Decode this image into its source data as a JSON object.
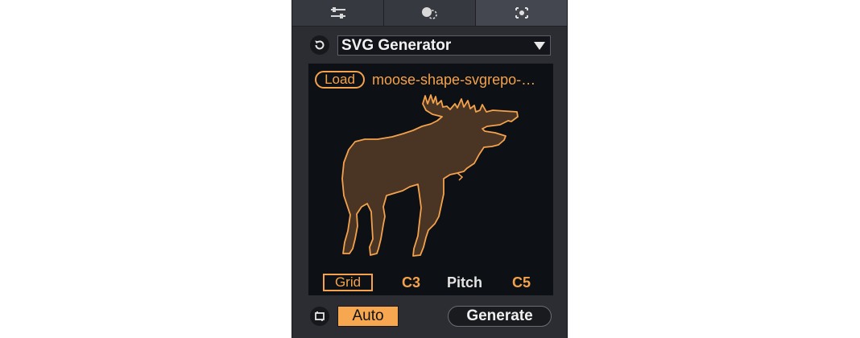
{
  "tabs": [
    {
      "icon": "sliders-icon",
      "active": false
    },
    {
      "icon": "shapes-icon",
      "active": false
    },
    {
      "icon": "target-icon",
      "active": true
    }
  ],
  "generator": {
    "reset_icon": "reset-icon",
    "selected": "SVG Generator"
  },
  "display": {
    "load_label": "Load",
    "filename": "moose-shape-svgrepo-…",
    "image": "moose-silhouette",
    "grid_label": "Grid",
    "range_low": "C3",
    "range_param": "Pitch",
    "range_high": "C5"
  },
  "footer": {
    "auto_icon": "loop-icon",
    "auto_label": "Auto",
    "generate_label": "Generate"
  },
  "colors": {
    "accent": "#f4a24b",
    "panel": "#2b2d33",
    "screen": "#0d1015",
    "moose_fill": "#4a3524"
  }
}
